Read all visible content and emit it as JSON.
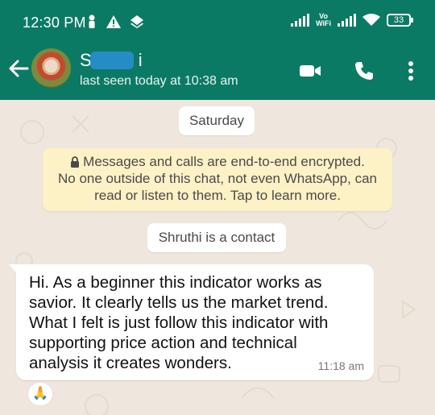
{
  "status_bar": {
    "time": "12:30 PM",
    "vowifi_top": "Vo",
    "vowifi_bottom": "WiFi",
    "battery": "33"
  },
  "header": {
    "contact_name_first": "S",
    "contact_name_last": "i",
    "last_seen": "last seen today at 10:38 am",
    "icons": [
      "back-arrow-icon",
      "video-call-icon",
      "voice-call-icon",
      "more-vert-icon"
    ]
  },
  "chat": {
    "date_chip": "Saturday",
    "encryption_notice": {
      "line1": "Messages and calls are end-to-end encrypted.",
      "line2": "No one outside of this chat, not even WhatsApp, can",
      "line3": "read or listen to them. Tap to learn more."
    },
    "contact_chip": "Shruthi is a contact",
    "message": {
      "lines": [
        "Hi. As a beginner this indicator works as",
        "savior. It clearly tells us the market trend.",
        "What I felt is just follow this indicator with",
        "supporting price action and technical",
        "analysis it creates wonders."
      ],
      "time": "11:18 am",
      "reaction": "🙏"
    }
  },
  "colors": {
    "header_bg": "#0b7a65",
    "chat_bg": "#efe7dd",
    "encryption_bg": "#fdf1c6",
    "bubble_bg": "#ffffff"
  }
}
